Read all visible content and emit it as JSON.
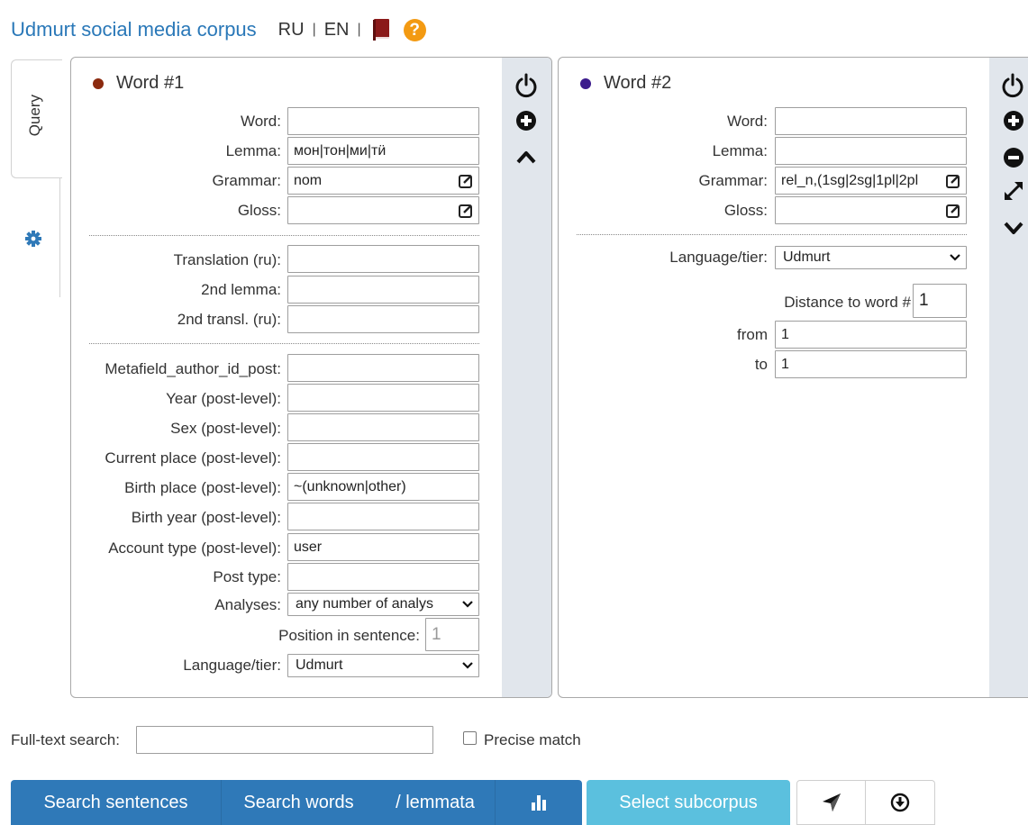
{
  "header": {
    "title": "Udmurt social media corpus",
    "lang_ru": "RU",
    "lang_en": "EN",
    "separator": "|",
    "help_symbol": "?",
    "book_icon": "book-icon",
    "help_icon": "question-circle-icon"
  },
  "sidebar": {
    "query_tab": "Query",
    "settings_icon": "gear-icon"
  },
  "word1": {
    "title": "Word #1",
    "dot_color": "#8b2a0e",
    "labels": {
      "word": "Word:",
      "lemma": "Lemma:",
      "grammar": "Grammar:",
      "gloss": "Gloss:",
      "translation": "Translation (ru):",
      "lemma2": "2nd lemma:",
      "transl2": "2nd transl. (ru):",
      "author_id": "Metafield_author_id_post:",
      "year": "Year (post-level):",
      "sex": "Sex (post-level):",
      "current_place": "Current place (post-level):",
      "birth_place": "Birth place (post-level):",
      "birth_year": "Birth year (post-level):",
      "account_type": "Account type (post-level):",
      "post_type": "Post type:",
      "analyses": "Analyses:",
      "position": "Position in sentence:",
      "language": "Language/tier:"
    },
    "values": {
      "word": "",
      "lemma": "мон|тон|ми|тӥ",
      "grammar": "nom",
      "gloss": "",
      "translation": "",
      "lemma2": "",
      "transl2": "",
      "author_id": "",
      "year": "",
      "sex": "",
      "current_place": "",
      "birth_place": "~(unknown|other)",
      "birth_year": "",
      "account_type": "user",
      "post_type": "",
      "analyses": "any number of analys",
      "position": "1",
      "language": "Udmurt"
    },
    "controls": [
      "power-icon",
      "plus-circle-icon",
      "chevron-up-icon"
    ]
  },
  "word2": {
    "title": "Word #2",
    "dot_color": "#3b1b8c",
    "labels": {
      "word": "Word:",
      "lemma": "Lemma:",
      "grammar": "Grammar:",
      "gloss": "Gloss:",
      "language": "Language/tier:",
      "distance": "Distance to word #",
      "from": "from",
      "to": "to"
    },
    "values": {
      "word": "",
      "lemma": "",
      "grammar": "rel_n,(1sg|2sg|1pl|2pl",
      "gloss": "",
      "language": "Udmurt",
      "distance_word": "1",
      "from": "1",
      "to": "1"
    },
    "controls": [
      "power-icon",
      "plus-circle-icon",
      "minus-circle-icon",
      "expand-arrows-icon",
      "chevron-down-icon"
    ]
  },
  "bottom": {
    "fulltext_label": "Full-text search:",
    "fulltext_value": "",
    "precise_label": "Precise match",
    "precise_checked": false
  },
  "buttons": {
    "search_sentences": "Search sentences",
    "search_words": "Search words",
    "lemmata": "/ lemmata",
    "select_subcorpus": "Select subcorpus",
    "stats_icon": "bar-chart-icon",
    "share_icon": "paper-plane-icon",
    "download_icon": "download-circle-icon"
  },
  "colors": {
    "primary": "#2f79b8",
    "info": "#5bc0de",
    "title_link": "#2a78b8",
    "help": "#f39a12",
    "book": "#8b1a1a"
  }
}
